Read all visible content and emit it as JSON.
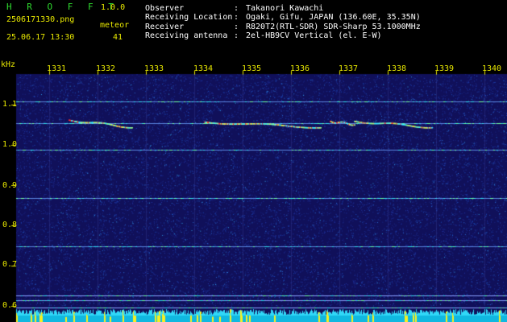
{
  "header": {
    "app_name": "H R O F F T",
    "version": "1.0.0",
    "file_name": "2506171330.png",
    "datetime": "25.06.17 13:30",
    "meteor_label": "meteor",
    "meteor_count": "41"
  },
  "station": [
    {
      "key": "Observer",
      "value": "Takanori Kawachi"
    },
    {
      "key": "Receiving Location",
      "value": "Ogaki, Gifu, JAPAN (136.60E, 35.35N)"
    },
    {
      "key": "Receiver",
      "value": "R820T2(RTL-SDR) SDR-Sharp 53.1000MHz"
    },
    {
      "key": "Receiving antenna",
      "value": "2el-HB9CV Vertical (el. E-W)"
    }
  ],
  "axis": {
    "y_unit": "kHz",
    "y_ticks": [
      "1.1",
      "1.0",
      "0.9",
      "0.8",
      "0.7",
      "0.6"
    ],
    "x_ticks": [
      "1331",
      "1332",
      "1333",
      "1334",
      "1335",
      "1336",
      "1337",
      "1338",
      "1339",
      "1340"
    ]
  },
  "colors": {
    "background": "#000000",
    "spectrogram_base": "#10105a",
    "label_yellow": "#e8e800",
    "title_green": "#2fdc2f",
    "noise_cyan": "#30e0f0"
  },
  "chart_data": {
    "type": "heatmap",
    "xlabel": "",
    "ylabel": "kHz",
    "x_range": [
      1331,
      1340
    ],
    "y_range": [
      0.59,
      1.155
    ],
    "x_ticks": [
      1331,
      1332,
      1333,
      1334,
      1335,
      1336,
      1337,
      1338,
      1339,
      1340
    ],
    "y_ticks": [
      1.1,
      1.0,
      0.9,
      0.8,
      0.7,
      0.6
    ],
    "carrier_lines_khz": [
      1.108,
      1.055,
      0.988,
      0.868,
      0.748,
      0.627,
      0.615,
      0.596
    ],
    "meteor_traces": [
      {
        "t_start": 1331.4,
        "f_start": 1.063,
        "t_end": 1332.7,
        "f_end": 1.045
      },
      {
        "t_start": 1334.2,
        "f_start": 1.058,
        "t_end": 1336.6,
        "f_end": 1.045
      },
      {
        "t_start": 1336.8,
        "f_start": 1.06,
        "t_end": 1337.3,
        "f_end": 1.052
      },
      {
        "t_start": 1337.3,
        "f_start": 1.06,
        "t_end": 1338.9,
        "f_end": 1.045
      }
    ],
    "grid": true
  }
}
